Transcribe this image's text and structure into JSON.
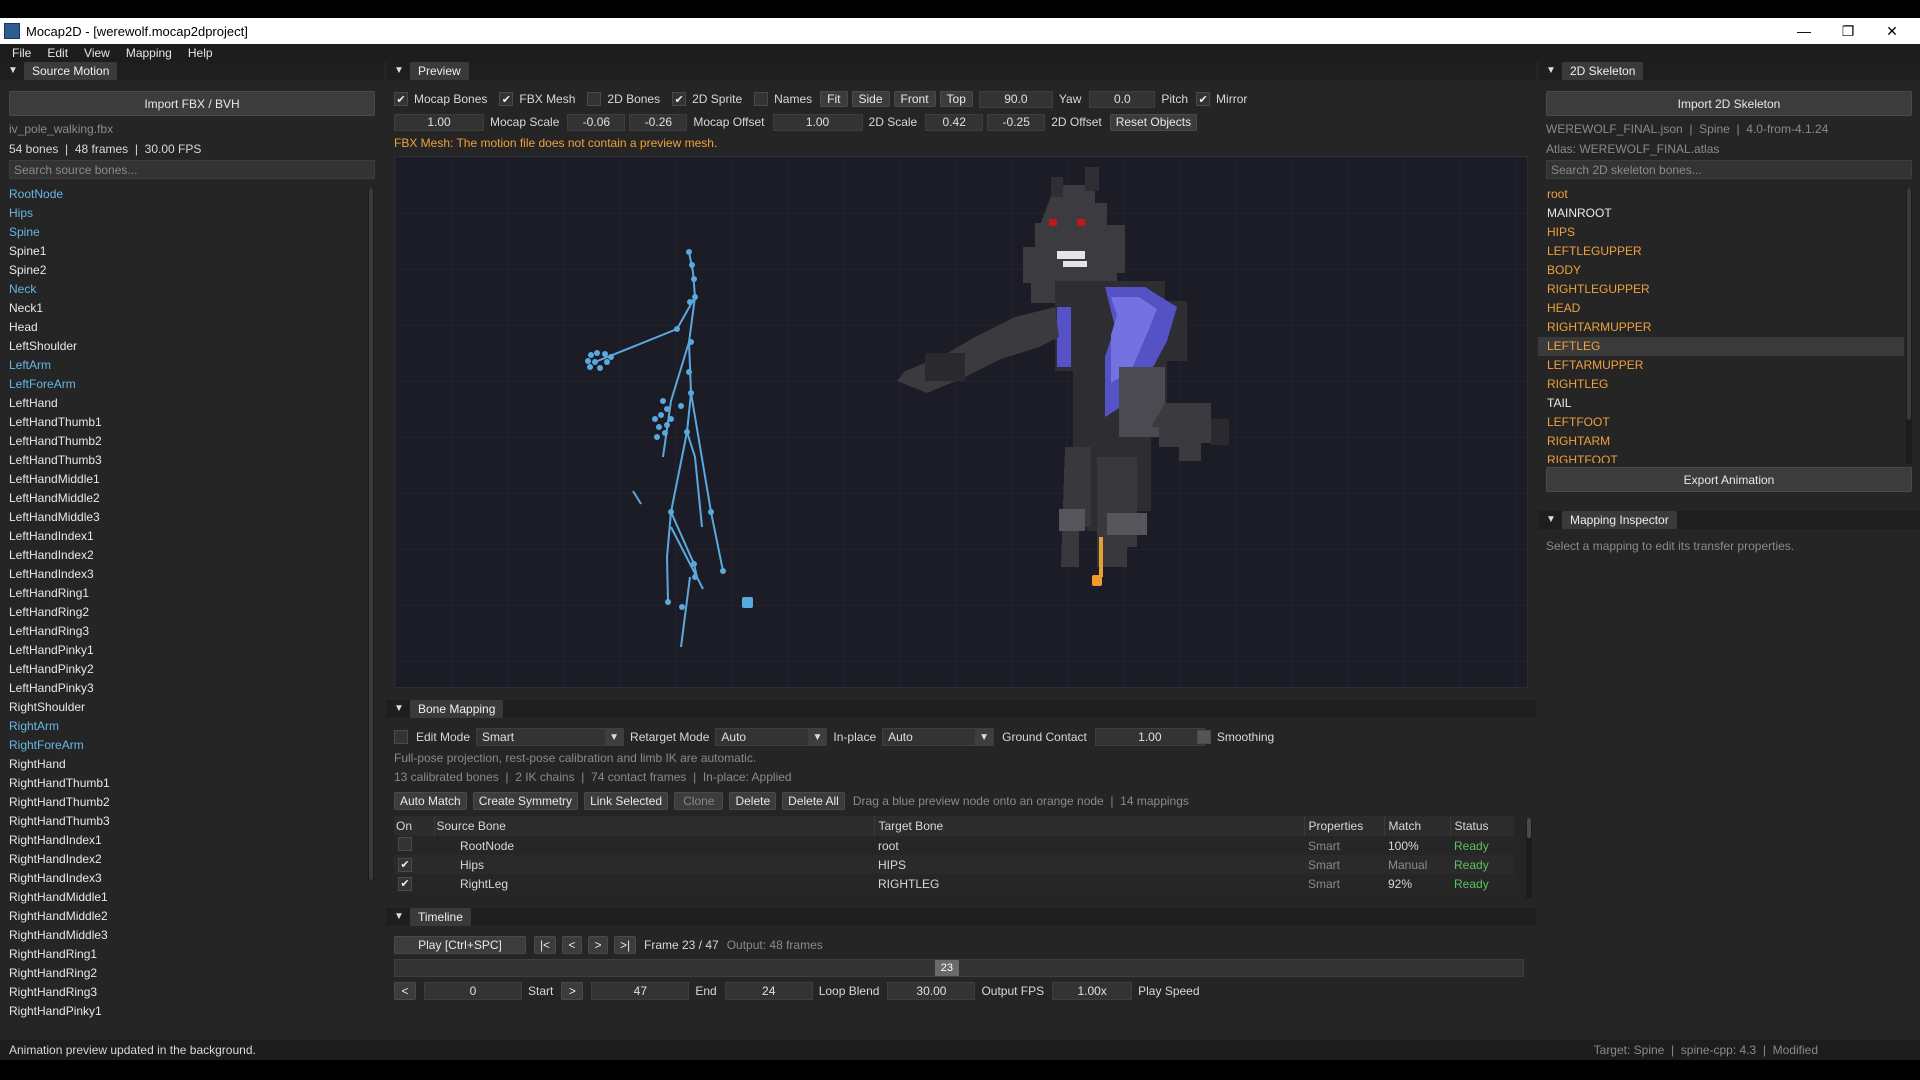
{
  "window": {
    "title": "Mocap2D - [werewolf.mocap2dproject]",
    "minimize": "—",
    "restore": "❐",
    "close": "✕"
  },
  "menu": [
    "File",
    "Edit",
    "View",
    "Mapping",
    "Help"
  ],
  "source": {
    "tab": "Source Motion",
    "import_label": "Import FBX / BVH",
    "file": "iv_pole_walking.fbx",
    "stats": "54 bones  |  48 frames  |  30.00 FPS",
    "search_placeholder": "Search source bones...",
    "bones": [
      {
        "name": "RootNode",
        "color": "blue"
      },
      {
        "name": "Hips",
        "color": "blue"
      },
      {
        "name": "Spine",
        "color": "blue"
      },
      {
        "name": "Spine1",
        "color": "white"
      },
      {
        "name": "Spine2",
        "color": "white"
      },
      {
        "name": "Neck",
        "color": "blue"
      },
      {
        "name": "Neck1",
        "color": "white"
      },
      {
        "name": "Head",
        "color": "white"
      },
      {
        "name": "LeftShoulder",
        "color": "white"
      },
      {
        "name": "LeftArm",
        "color": "blue"
      },
      {
        "name": "LeftForeArm",
        "color": "blue"
      },
      {
        "name": "LeftHand",
        "color": "white"
      },
      {
        "name": "LeftHandThumb1",
        "color": "white"
      },
      {
        "name": "LeftHandThumb2",
        "color": "white"
      },
      {
        "name": "LeftHandThumb3",
        "color": "white"
      },
      {
        "name": "LeftHandMiddle1",
        "color": "white"
      },
      {
        "name": "LeftHandMiddle2",
        "color": "white"
      },
      {
        "name": "LeftHandMiddle3",
        "color": "white"
      },
      {
        "name": "LeftHandIndex1",
        "color": "white"
      },
      {
        "name": "LeftHandIndex2",
        "color": "white"
      },
      {
        "name": "LeftHandIndex3",
        "color": "white"
      },
      {
        "name": "LeftHandRing1",
        "color": "white"
      },
      {
        "name": "LeftHandRing2",
        "color": "white"
      },
      {
        "name": "LeftHandRing3",
        "color": "white"
      },
      {
        "name": "LeftHandPinky1",
        "color": "white"
      },
      {
        "name": "LeftHandPinky2",
        "color": "white"
      },
      {
        "name": "LeftHandPinky3",
        "color": "white"
      },
      {
        "name": "RightShoulder",
        "color": "white"
      },
      {
        "name": "RightArm",
        "color": "blue"
      },
      {
        "name": "RightForeArm",
        "color": "blue"
      },
      {
        "name": "RightHand",
        "color": "white"
      },
      {
        "name": "RightHandThumb1",
        "color": "white"
      },
      {
        "name": "RightHandThumb2",
        "color": "white"
      },
      {
        "name": "RightHandThumb3",
        "color": "white"
      },
      {
        "name": "RightHandIndex1",
        "color": "white"
      },
      {
        "name": "RightHandIndex2",
        "color": "white"
      },
      {
        "name": "RightHandIndex3",
        "color": "white"
      },
      {
        "name": "RightHandMiddle1",
        "color": "white"
      },
      {
        "name": "RightHandMiddle2",
        "color": "white"
      },
      {
        "name": "RightHandMiddle3",
        "color": "white"
      },
      {
        "name": "RightHandRing1",
        "color": "white"
      },
      {
        "name": "RightHandRing2",
        "color": "white"
      },
      {
        "name": "RightHandRing3",
        "color": "white"
      },
      {
        "name": "RightHandPinky1",
        "color": "white"
      }
    ]
  },
  "preview": {
    "tab": "Preview",
    "toggles": [
      {
        "label": "Mocap Bones",
        "checked": true
      },
      {
        "label": "FBX Mesh",
        "checked": true
      },
      {
        "label": "2D Bones",
        "checked": false
      },
      {
        "label": "2D Sprite",
        "checked": true
      },
      {
        "label": "Names",
        "checked": false
      }
    ],
    "view_buttons": [
      "Fit",
      "Side",
      "Front",
      "Top"
    ],
    "yaw_value": "90.0",
    "yaw_label": "Yaw",
    "pitch_value": "0.0",
    "pitch_label": "Pitch",
    "mirror_label": "Mirror",
    "mirror_checked": true,
    "mocap_scale_value": "1.00",
    "mocap_scale_label": "Mocap Scale",
    "mocap_offset_x": "-0.06",
    "mocap_offset_y": "-0.26",
    "mocap_offset_label": "Mocap Offset",
    "scale2d_value": "1.00",
    "scale2d_label": "2D Scale",
    "offset2d_x": "0.42",
    "offset2d_y": "-0.25",
    "offset2d_label": "2D Offset",
    "reset_label": "Reset Objects",
    "warning": "FBX Mesh: The motion file does not contain a preview mesh."
  },
  "skeleton": {
    "tab": "2D Skeleton",
    "import_label": "Import 2D Skeleton",
    "info": "WEREWOLF_FINAL.json  |  Spine  |  4.0-from-4.1.24",
    "atlas": "Atlas: WEREWOLF_FINAL.atlas",
    "search_placeholder": "Search 2D skeleton bones...",
    "bones": [
      {
        "name": "root",
        "color": "orange"
      },
      {
        "name": "MAINROOT",
        "color": "white"
      },
      {
        "name": "HIPS",
        "color": "orange"
      },
      {
        "name": "LEFTLEGUPPER",
        "color": "orange"
      },
      {
        "name": "BODY",
        "color": "orange"
      },
      {
        "name": "RIGHTLEGUPPER",
        "color": "orange"
      },
      {
        "name": "HEAD",
        "color": "orange"
      },
      {
        "name": "RIGHTARMUPPER",
        "color": "orange"
      },
      {
        "name": "LEFTLEG",
        "color": "orange",
        "selected": true
      },
      {
        "name": "LEFTARMUPPER",
        "color": "orange"
      },
      {
        "name": "RIGHTLEG",
        "color": "orange"
      },
      {
        "name": "TAIL",
        "color": "white"
      },
      {
        "name": "LEFTFOOT",
        "color": "orange"
      },
      {
        "name": "RIGHTARM",
        "color": "orange"
      },
      {
        "name": "RIGHTFOOT",
        "color": "orange"
      }
    ],
    "export_label": "Export Animation"
  },
  "inspector": {
    "tab": "Mapping Inspector",
    "hint": "Select a mapping to edit its transfer properties."
  },
  "mapping": {
    "tab": "Bone Mapping",
    "edit_mode_label": "Edit Mode",
    "edit_mode_value": "Smart",
    "retarget_label": "Retarget Mode",
    "retarget_value": "Auto",
    "inplace_label": "In-place",
    "inplace_value": "Auto",
    "ground_label": "Ground Contact",
    "ground_value": "1.00",
    "smoothing_label": "Smoothing",
    "note": "Full-pose projection, rest-pose calibration and limb IK are automatic.",
    "stats": "13 calibrated bones  |  2 IK chains  |  74 contact frames  |  In-place: Applied",
    "buttons": [
      {
        "label": "Auto Match",
        "enabled": true
      },
      {
        "label": "Create Symmetry",
        "enabled": true
      },
      {
        "label": "Link Selected",
        "enabled": true
      },
      {
        "label": "Clone",
        "enabled": false
      },
      {
        "label": "Delete",
        "enabled": true
      },
      {
        "label": "Delete All",
        "enabled": true
      }
    ],
    "hint": "Drag a blue preview node onto an orange node  |  14 mappings",
    "columns": [
      "On",
      "Source Bone",
      "Target Bone",
      "Properties",
      "Match",
      "Status"
    ],
    "rows": [
      {
        "on": false,
        "source": "RootNode",
        "target": "root",
        "props": "Smart",
        "match": "100%",
        "status": "Ready"
      },
      {
        "on": true,
        "source": "Hips",
        "target": "HIPS",
        "props": "Smart",
        "match": "Manual",
        "status": "Ready"
      },
      {
        "on": true,
        "source": "RightLeg",
        "target": "RIGHTLEG",
        "props": "Smart",
        "match": "92%",
        "status": "Ready"
      }
    ]
  },
  "timeline": {
    "tab": "Timeline",
    "play_label": "Play [Ctrl+SPC]",
    "nav": [
      "|<",
      "<",
      ">",
      ">|"
    ],
    "frame_text": "Frame 23 / 47",
    "output_text": "Output: 48 frames",
    "scrub_value": "23",
    "scrub_fraction": 0.489,
    "start_dec": "<",
    "start_value": "0",
    "start_label": "Start",
    "start_inc": ">",
    "end_value": "47",
    "end_label": "End",
    "loop_value": "24",
    "loop_label": "Loop Blend",
    "fps_value": "30.00",
    "fps_label": "Output FPS",
    "speed_value": "1.00x",
    "speed_label": "Play Speed"
  },
  "status": {
    "left": "Animation preview updated in the background.",
    "right": "Target: Spine  |  spine-cpp: 4.3  |  Modified"
  },
  "colors": {
    "source_bone": "#67b7e6",
    "target_bone": "#f0a040",
    "ready": "#5ec05e",
    "warning": "#f0a040"
  }
}
